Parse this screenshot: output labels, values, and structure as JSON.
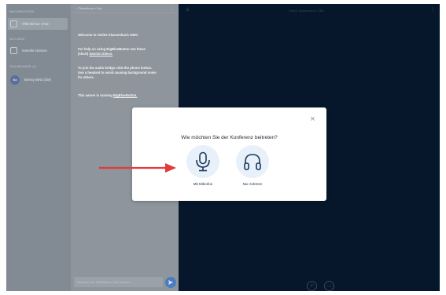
{
  "sidebar": {
    "messages_heading": "NACHRICHTEN",
    "public_chat_label": "Öffentlicher Chat",
    "notes_heading": "NOTIZEN",
    "shared_notes_label": "Geteilte Notizen",
    "users_heading": "TEILNEHMER (1)",
    "user_initials": "Ba",
    "user_name": "Benny Beta (Sie)"
  },
  "chat": {
    "title": "‹ Öffentlicher Chat",
    "welcome_line1": "Welcome to Online Klassenbuch GBK!",
    "help_line1": "For help on using BigBlueButton see these",
    "help_line2": "(short)",
    "help_link": "tutorial videos.",
    "audio_line1": "To join the audio bridge click the phone button.",
    "audio_line2": "Use a headset to avoid causing background noise",
    "audio_line3": "for others.",
    "server_line": "This server is running",
    "server_link": "BigBlueButton.",
    "input_placeholder": "Nachricht an Öffentlicher Chat senden"
  },
  "main": {
    "title": "Online Klassenbuch GBK"
  },
  "modal": {
    "question": "Wie möchten Sie der Konferenz beitreten?",
    "close_glyph": "×",
    "option_microphone_label": "Mit Mikrofon",
    "option_listen_label": "Nur zuhören"
  },
  "icons": {
    "close": "close-icon",
    "microphone": "microphone-icon",
    "headphones": "headphones-icon",
    "arrow": "arrow-right-icon",
    "send": "send-icon"
  },
  "colors": {
    "stage_bg": "#06172b",
    "option_bg": "#e8f0f9",
    "icon_blue": "#1b3a5e",
    "arrow_red": "#e23b3b",
    "send_blue": "#4a7cc2"
  }
}
